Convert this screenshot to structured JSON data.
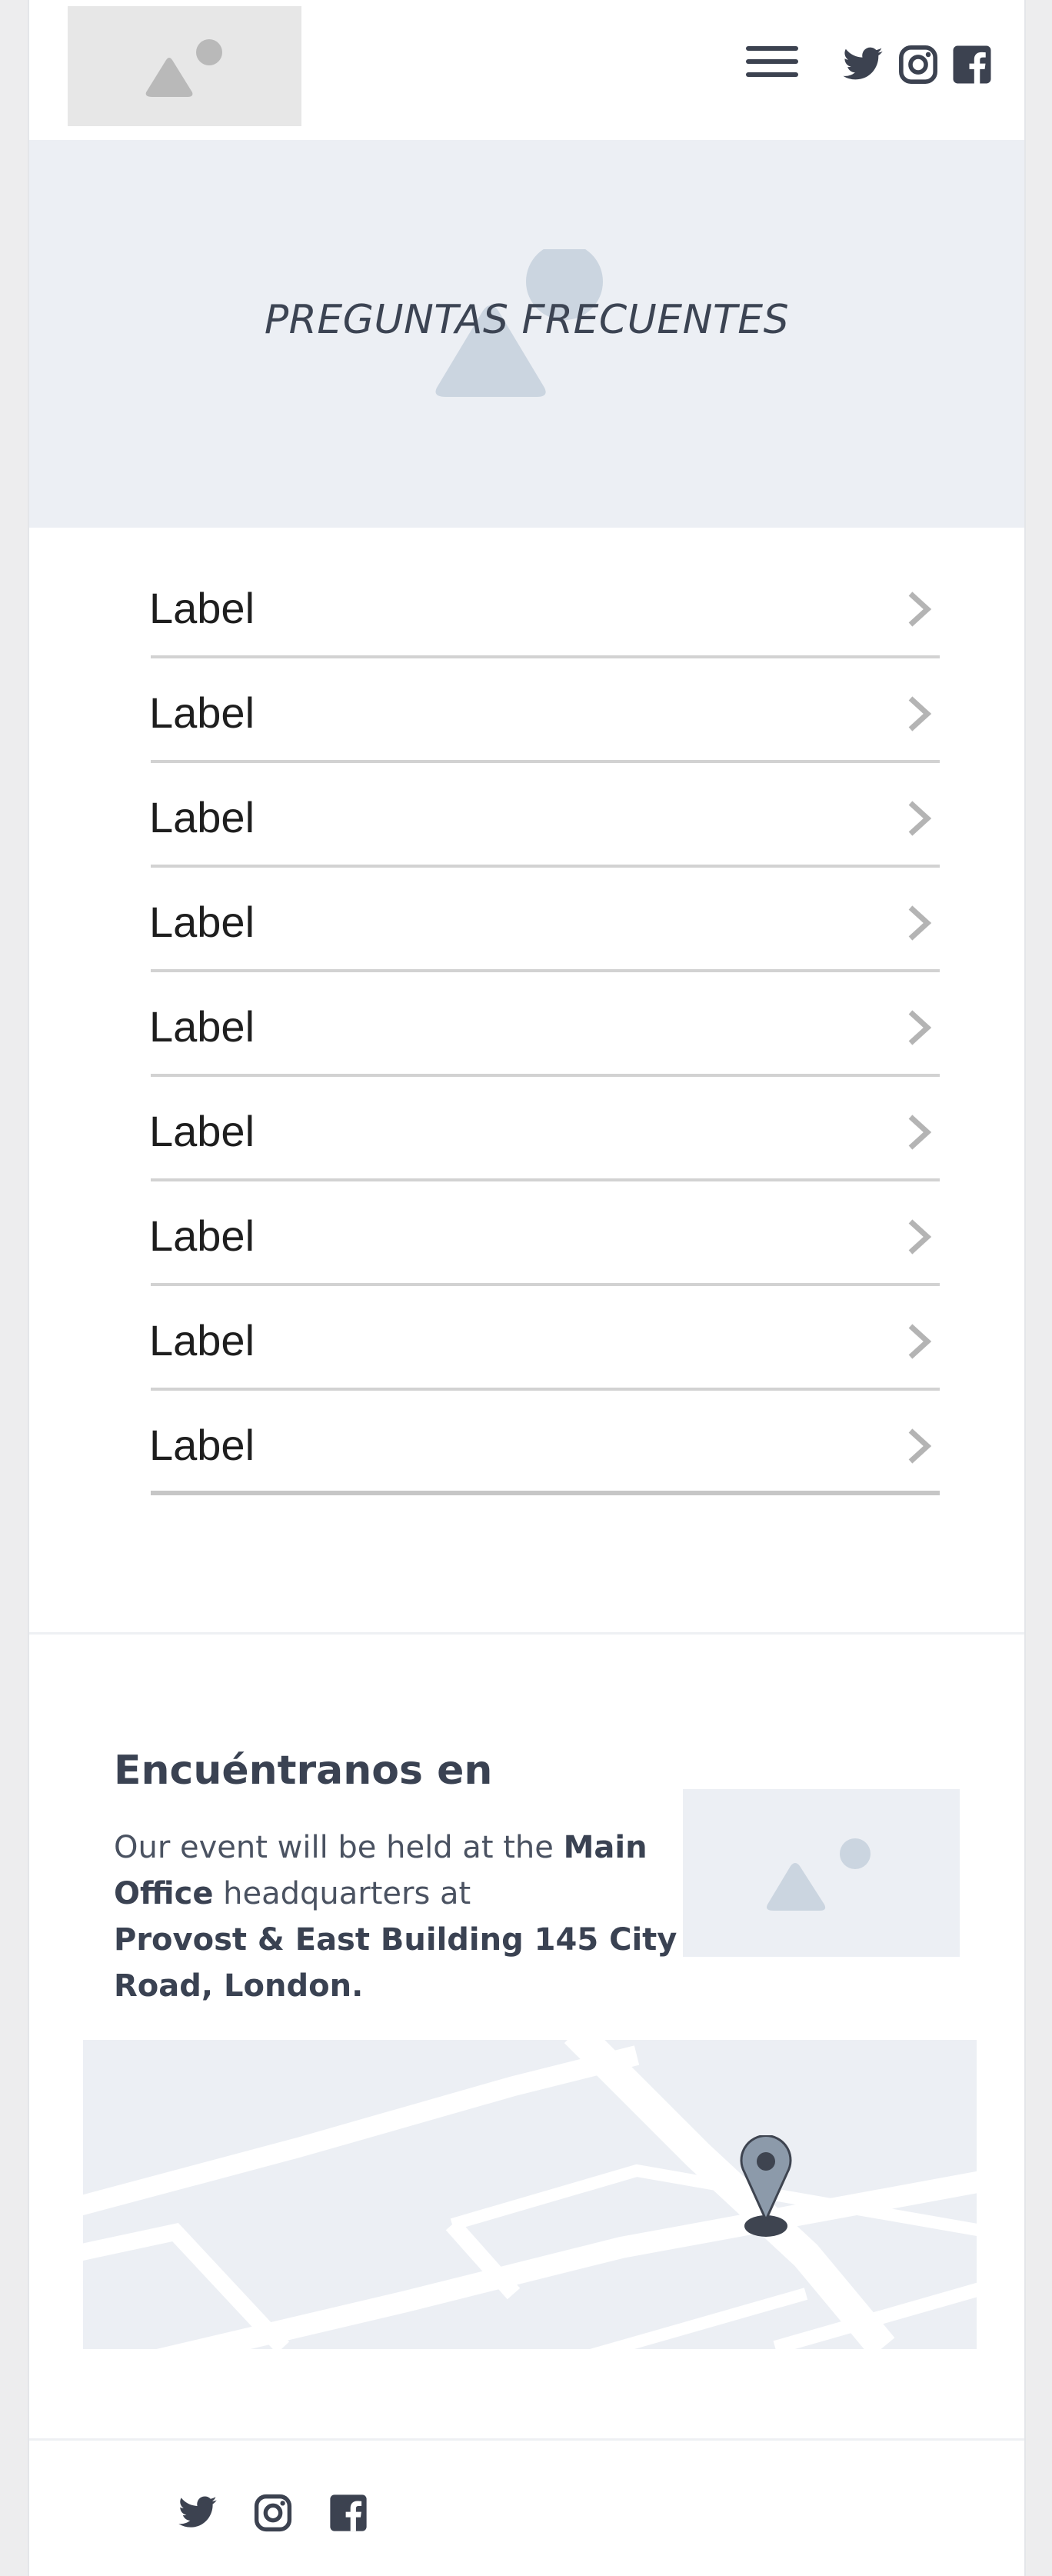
{
  "header": {
    "logo": "image-placeholder-icon",
    "menu_icon": "hamburger-menu-icon",
    "social": [
      "twitter-icon",
      "instagram-icon",
      "facebook-icon"
    ]
  },
  "hero": {
    "title": "PREGUNTAS FRECUENTES"
  },
  "faq": {
    "items": [
      {
        "label": "Label"
      },
      {
        "label": "Label"
      },
      {
        "label": "Label"
      },
      {
        "label": "Label"
      },
      {
        "label": "Label"
      },
      {
        "label": "Label"
      },
      {
        "label": "Label"
      },
      {
        "label": "Label"
      },
      {
        "label": "Label"
      }
    ],
    "chevron_icon": "chevron-right-icon"
  },
  "location": {
    "title": "Encuéntranos en",
    "text_1": "Our event will be held at the ",
    "text_bold_1": "Main Office",
    "text_2": " headquarters at ",
    "text_bold_2": "Provost & East Building 145 City Road, London.",
    "map_pin_icon": "map-pin-icon"
  },
  "footer": {
    "social": [
      "twitter-icon",
      "instagram-icon",
      "facebook-icon"
    ]
  },
  "colors": {
    "icon_dark": "#3c4250",
    "hero_bg": "#eceff4",
    "placeholder_gray": "#e7e7e7",
    "chevron": "#b4b4b4"
  }
}
